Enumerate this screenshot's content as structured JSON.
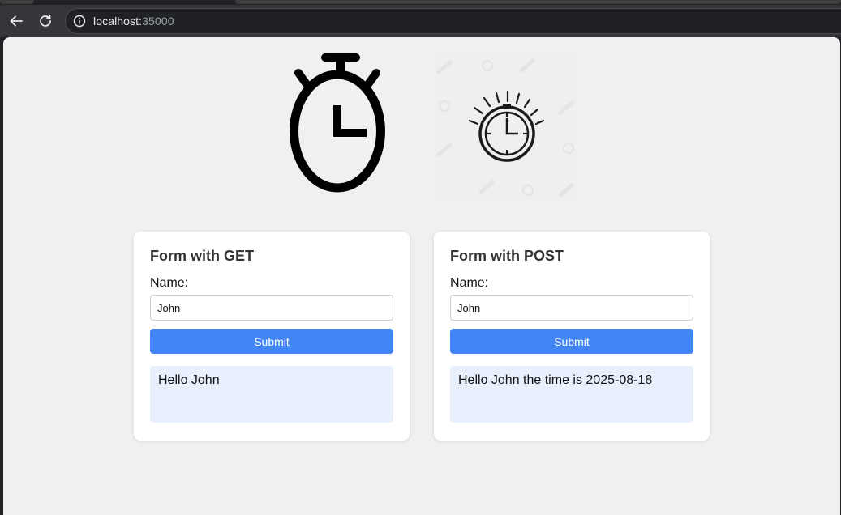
{
  "browser": {
    "url_host": "localhost:",
    "url_port": "35000",
    "icons": {
      "back": "arrow-left-icon",
      "reload": "reload-icon",
      "site_info": "info-circle-icon"
    }
  },
  "page": {
    "hero": {
      "left_icon": "stopwatch-icon",
      "right_icon": "stopwatch-ticking-icon"
    },
    "get_form": {
      "title": "Form with GET",
      "name_label": "Name:",
      "name_value": "John",
      "submit_label": "Submit",
      "result": "Hello John"
    },
    "post_form": {
      "title": "Form with POST",
      "name_label": "Name:",
      "name_value": "John",
      "submit_label": "Submit",
      "result": "Hello John the time is 2025-08-18"
    },
    "colors": {
      "accent": "#4285f4",
      "result_bg": "#e8f0fd",
      "page_bg": "#f0f0f0"
    }
  }
}
